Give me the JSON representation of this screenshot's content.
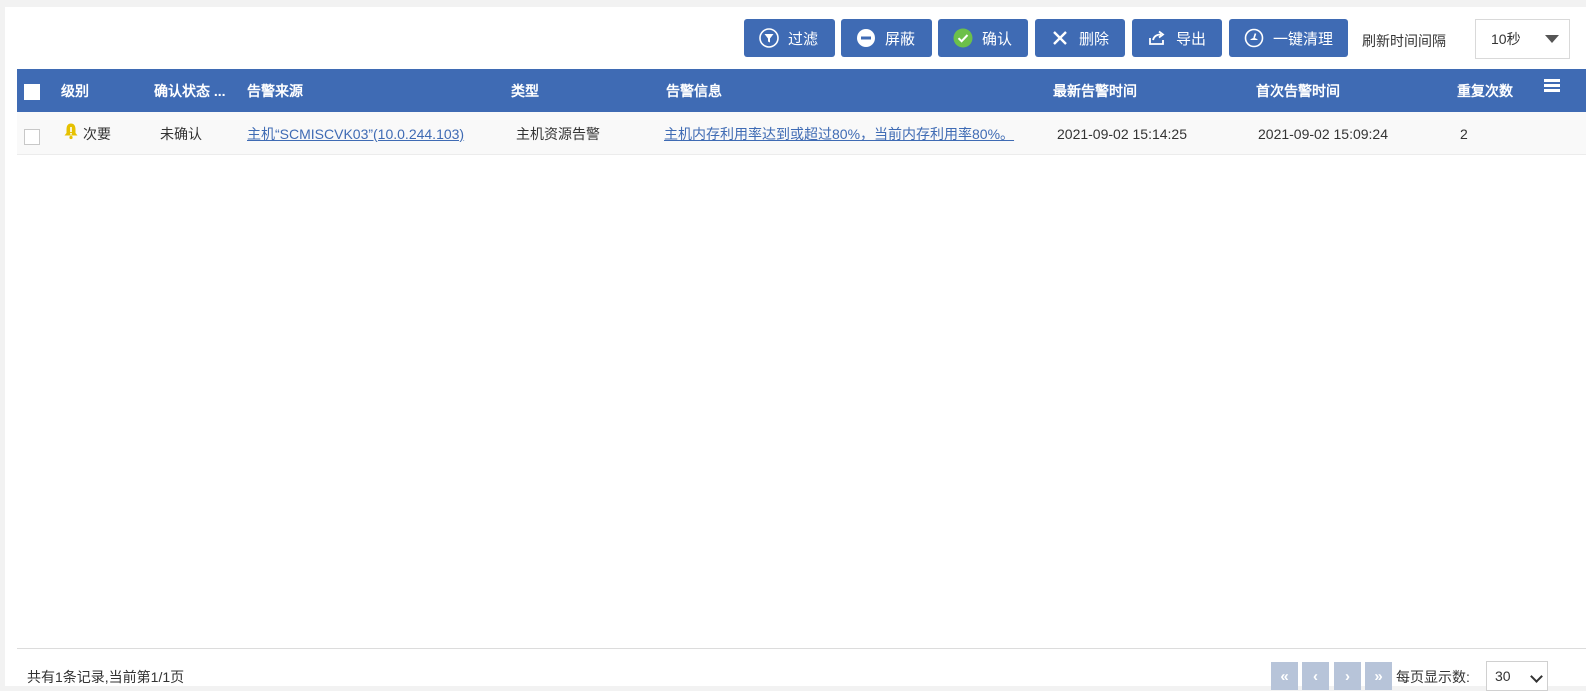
{
  "toolbar": {
    "buttons": [
      {
        "label": "过滤",
        "icon": "filter-icon"
      },
      {
        "label": "屏蔽",
        "icon": "block-icon"
      },
      {
        "label": "确认",
        "icon": "check-icon"
      },
      {
        "label": "删除",
        "icon": "close-icon"
      },
      {
        "label": "导出",
        "icon": "export-icon"
      },
      {
        "label": "一键清理",
        "icon": "clean-icon"
      }
    ],
    "refresh_label": "刷新时间间隔",
    "refresh_value": "10秒"
  },
  "table": {
    "columns": [
      "级别",
      "确认状态 ...",
      "告警来源",
      "类型",
      "告警信息",
      "最新告警时间",
      "首次告警时间",
      "重复次数"
    ],
    "rows": [
      {
        "level": "次要",
        "status": "未确认",
        "source": "主机“SCMISCVK03”(10.0.244.103)",
        "type": "主机资源告警",
        "message": "主机内存利用率达到或超过80%，当前内存利用率80%。",
        "latest_time": "2021-09-02 15:14:25",
        "first_time": "2021-09-02 15:09:24",
        "repeat": "2"
      }
    ]
  },
  "footer": {
    "summary": "共有1条记录,当前第1/1页",
    "pager": [
      "«",
      "‹",
      "›",
      "»"
    ],
    "perpage_label": "每页显示数:",
    "perpage_value": "30"
  },
  "colors": {
    "accent": "#3f6bb4",
    "warning": "#e6c100",
    "confirm": "#6cc04a"
  }
}
